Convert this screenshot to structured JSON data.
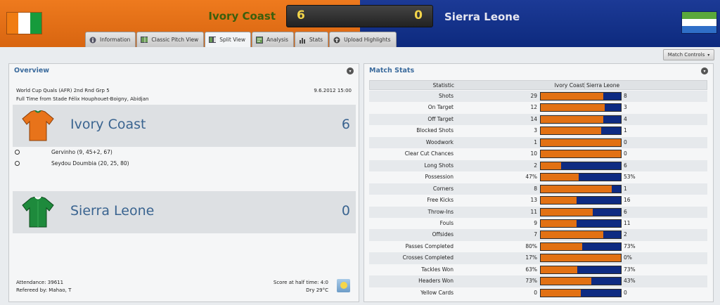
{
  "header": {
    "home_team": "Ivory Coast",
    "away_team": "Sierra Leone",
    "home_score": "6",
    "away_score": "0",
    "home_color": "#e06a12",
    "away_color": "#12307f"
  },
  "tabs": [
    {
      "label": "Information",
      "icon": "info-icon"
    },
    {
      "label": "Classic Pitch View",
      "icon": "pitch-icon"
    },
    {
      "label": "Split View",
      "icon": "split-view-icon"
    },
    {
      "label": "Analysis",
      "icon": "analysis-icon"
    },
    {
      "label": "Stats",
      "icon": "stats-icon"
    },
    {
      "label": "Upload Highlights",
      "icon": "upload-icon"
    }
  ],
  "active_tab": "Split View",
  "match_controls_label": "Match Controls",
  "overview": {
    "title": "Overview",
    "competition": "World Cup Quals (AFR) 2nd Rnd Grp 5",
    "date": "9.6.2012 15:00",
    "venue": "Full Time from Stade Félix Houphouet-Boigny, Abidjan",
    "home_team": "Ivory Coast",
    "home_score": "6",
    "away_team": "Sierra Leone",
    "away_score": "0",
    "scorers": [
      "Gervinho (9, 45+2, 67)",
      "Seydou Doumbia (20, 25, 80)"
    ],
    "attendance": "Attendance: 39611",
    "referee": "Refereed by: Mahao, T",
    "half_time": "Score at half time: 4:0",
    "weather": "Dry 29°C"
  },
  "match_stats": {
    "title": "Match Stats",
    "headers": {
      "statistic": "Statistic",
      "home": "Ivory Coast",
      "away": "Sierra Leone"
    },
    "rows": [
      {
        "name": "Shots",
        "home": "29",
        "away": "8",
        "home_share": 0.78
      },
      {
        "name": "On Target",
        "home": "12",
        "away": "3",
        "home_share": 0.8
      },
      {
        "name": "Off Target",
        "home": "14",
        "away": "4",
        "home_share": 0.78
      },
      {
        "name": "Blocked Shots",
        "home": "3",
        "away": "1",
        "home_share": 0.75
      },
      {
        "name": "Woodwork",
        "home": "1",
        "away": "0",
        "home_share": 1.0
      },
      {
        "name": "Clear Cut Chances",
        "home": "10",
        "away": "0",
        "home_share": 1.0
      },
      {
        "name": "Long Shots",
        "home": "2",
        "away": "6",
        "home_share": 0.25
      },
      {
        "name": "Possession",
        "home": "47%",
        "away": "53%",
        "home_share": 0.47
      },
      {
        "name": "Corners",
        "home": "8",
        "away": "1",
        "home_share": 0.89
      },
      {
        "name": "Free Kicks",
        "home": "13",
        "away": "16",
        "home_share": 0.45
      },
      {
        "name": "Throw-Ins",
        "home": "11",
        "away": "6",
        "home_share": 0.65
      },
      {
        "name": "Fouls",
        "home": "9",
        "away": "11",
        "home_share": 0.45
      },
      {
        "name": "Offsides",
        "home": "7",
        "away": "2",
        "home_share": 0.78
      },
      {
        "name": "Passes Completed",
        "home": "80%",
        "away": "73%",
        "home_share": 0.52
      },
      {
        "name": "Crosses Completed",
        "home": "17%",
        "away": "0%",
        "home_share": 1.0
      },
      {
        "name": "Tackles Won",
        "home": "63%",
        "away": "73%",
        "home_share": 0.46
      },
      {
        "name": "Headers Won",
        "home": "73%",
        "away": "43%",
        "home_share": 0.63
      },
      {
        "name": "Yellow Cards",
        "home": "0",
        "away": "0",
        "home_share": 0.5
      }
    ]
  }
}
